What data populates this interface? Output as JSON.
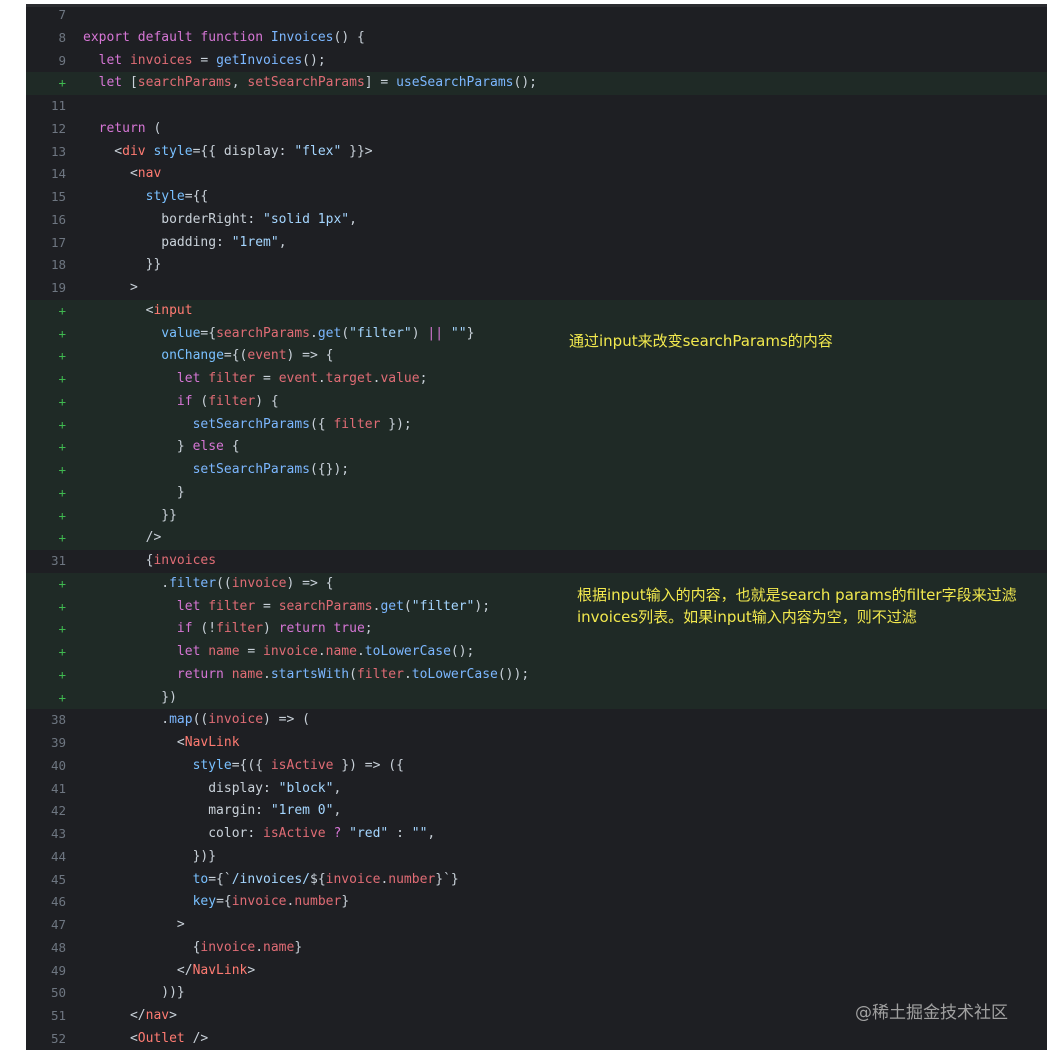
{
  "editor": {
    "lines": [
      {
        "n": "7",
        "added": false,
        "tokens": []
      },
      {
        "n": "8",
        "added": false,
        "tokens": [
          [
            "kw",
            "export "
          ],
          [
            "kw",
            "default "
          ],
          [
            "kw",
            "function "
          ],
          [
            "fn",
            "Invoices"
          ],
          [
            "p",
            "() {"
          ]
        ]
      },
      {
        "n": "9",
        "added": false,
        "tokens": [
          [
            "p",
            "  "
          ],
          [
            "kw",
            "let "
          ],
          [
            "var",
            "invoices"
          ],
          [
            "p",
            " = "
          ],
          [
            "fn",
            "getInvoices"
          ],
          [
            "p",
            "();"
          ]
        ]
      },
      {
        "n": "+",
        "added": true,
        "tokens": [
          [
            "p",
            "  "
          ],
          [
            "kw",
            "let "
          ],
          [
            "p",
            "["
          ],
          [
            "var",
            "searchParams"
          ],
          [
            "p",
            ", "
          ],
          [
            "var",
            "setSearchParams"
          ],
          [
            "p",
            "] = "
          ],
          [
            "fn",
            "useSearchParams"
          ],
          [
            "p",
            "();"
          ]
        ]
      },
      {
        "n": "11",
        "added": false,
        "tokens": []
      },
      {
        "n": "12",
        "added": false,
        "tokens": [
          [
            "p",
            "  "
          ],
          [
            "kw",
            "return "
          ],
          [
            "p",
            "("
          ]
        ]
      },
      {
        "n": "13",
        "added": false,
        "tokens": [
          [
            "p",
            "    <"
          ],
          [
            "tag",
            "div "
          ],
          [
            "attr",
            "style"
          ],
          [
            "p",
            "={{ display: "
          ],
          [
            "str",
            "\"flex\""
          ],
          [
            "p",
            " }}>"
          ]
        ]
      },
      {
        "n": "14",
        "added": false,
        "tokens": [
          [
            "p",
            "      <"
          ],
          [
            "tag",
            "nav"
          ]
        ]
      },
      {
        "n": "15",
        "added": false,
        "tokens": [
          [
            "p",
            "        "
          ],
          [
            "attr",
            "style"
          ],
          [
            "p",
            "={{"
          ]
        ]
      },
      {
        "n": "16",
        "added": false,
        "tokens": [
          [
            "p",
            "          borderRight: "
          ],
          [
            "str",
            "\"solid 1px\""
          ],
          [
            "p",
            ","
          ]
        ]
      },
      {
        "n": "17",
        "added": false,
        "tokens": [
          [
            "p",
            "          padding: "
          ],
          [
            "str",
            "\"1rem\""
          ],
          [
            "p",
            ","
          ]
        ]
      },
      {
        "n": "18",
        "added": false,
        "tokens": [
          [
            "p",
            "        }}"
          ]
        ]
      },
      {
        "n": "19",
        "added": false,
        "tokens": [
          [
            "p",
            "      >"
          ]
        ]
      },
      {
        "n": "+",
        "added": true,
        "tokens": [
          [
            "p",
            "        <"
          ],
          [
            "tag",
            "input"
          ]
        ]
      },
      {
        "n": "+",
        "added": true,
        "tokens": [
          [
            "p",
            "          "
          ],
          [
            "attr",
            "value"
          ],
          [
            "p",
            "={"
          ],
          [
            "var",
            "searchParams"
          ],
          [
            "p",
            "."
          ],
          [
            "fn",
            "get"
          ],
          [
            "p",
            "("
          ],
          [
            "str",
            "\"filter\""
          ],
          [
            "p",
            ") "
          ],
          [
            "kw",
            "||"
          ],
          [
            "p",
            " "
          ],
          [
            "str",
            "\"\""
          ],
          [
            "p",
            "}"
          ]
        ]
      },
      {
        "n": "+",
        "added": true,
        "tokens": [
          [
            "p",
            "          "
          ],
          [
            "attr",
            "onChange"
          ],
          [
            "p",
            "={("
          ],
          [
            "var",
            "event"
          ],
          [
            "p",
            ") => {"
          ]
        ]
      },
      {
        "n": "+",
        "added": true,
        "tokens": [
          [
            "p",
            "            "
          ],
          [
            "kw",
            "let "
          ],
          [
            "var",
            "filter"
          ],
          [
            "p",
            " = "
          ],
          [
            "var",
            "event"
          ],
          [
            "p",
            "."
          ],
          [
            "var",
            "target"
          ],
          [
            "p",
            "."
          ],
          [
            "var",
            "value"
          ],
          [
            "p",
            ";"
          ]
        ]
      },
      {
        "n": "+",
        "added": true,
        "tokens": [
          [
            "p",
            "            "
          ],
          [
            "kw",
            "if "
          ],
          [
            "p",
            "("
          ],
          [
            "var",
            "filter"
          ],
          [
            "p",
            ") {"
          ]
        ]
      },
      {
        "n": "+",
        "added": true,
        "tokens": [
          [
            "p",
            "              "
          ],
          [
            "fn",
            "setSearchParams"
          ],
          [
            "p",
            "({ "
          ],
          [
            "var",
            "filter"
          ],
          [
            "p",
            " });"
          ]
        ]
      },
      {
        "n": "+",
        "added": true,
        "tokens": [
          [
            "p",
            "            } "
          ],
          [
            "kw",
            "else "
          ],
          [
            "p",
            "{"
          ]
        ]
      },
      {
        "n": "+",
        "added": true,
        "tokens": [
          [
            "p",
            "              "
          ],
          [
            "fn",
            "setSearchParams"
          ],
          [
            "p",
            "({});"
          ]
        ]
      },
      {
        "n": "+",
        "added": true,
        "tokens": [
          [
            "p",
            "            }"
          ]
        ]
      },
      {
        "n": "+",
        "added": true,
        "tokens": [
          [
            "p",
            "          }}"
          ]
        ]
      },
      {
        "n": "+",
        "added": true,
        "tokens": [
          [
            "p",
            "        />"
          ]
        ]
      },
      {
        "n": "31",
        "added": false,
        "tokens": [
          [
            "p",
            "        {"
          ],
          [
            "var",
            "invoices"
          ]
        ]
      },
      {
        "n": "+",
        "added": true,
        "tokens": [
          [
            "p",
            "          ."
          ],
          [
            "fn",
            "filter"
          ],
          [
            "p",
            "(("
          ],
          [
            "var",
            "invoice"
          ],
          [
            "p",
            ") => {"
          ]
        ]
      },
      {
        "n": "+",
        "added": true,
        "tokens": [
          [
            "p",
            "            "
          ],
          [
            "kw",
            "let "
          ],
          [
            "var",
            "filter"
          ],
          [
            "p",
            " = "
          ],
          [
            "var",
            "searchParams"
          ],
          [
            "p",
            "."
          ],
          [
            "fn",
            "get"
          ],
          [
            "p",
            "("
          ],
          [
            "str",
            "\"filter\""
          ],
          [
            "p",
            ");"
          ]
        ]
      },
      {
        "n": "+",
        "added": true,
        "tokens": [
          [
            "p",
            "            "
          ],
          [
            "kw",
            "if "
          ],
          [
            "p",
            "(!"
          ],
          [
            "var",
            "filter"
          ],
          [
            "p",
            ") "
          ],
          [
            "kw",
            "return "
          ],
          [
            "kw",
            "true"
          ],
          [
            "p",
            ";"
          ]
        ]
      },
      {
        "n": "+",
        "added": true,
        "tokens": [
          [
            "p",
            "            "
          ],
          [
            "kw",
            "let "
          ],
          [
            "var",
            "name"
          ],
          [
            "p",
            " = "
          ],
          [
            "var",
            "invoice"
          ],
          [
            "p",
            "."
          ],
          [
            "var",
            "name"
          ],
          [
            "p",
            "."
          ],
          [
            "fn",
            "toLowerCase"
          ],
          [
            "p",
            "();"
          ]
        ]
      },
      {
        "n": "+",
        "added": true,
        "tokens": [
          [
            "p",
            "            "
          ],
          [
            "kw",
            "return "
          ],
          [
            "var",
            "name"
          ],
          [
            "p",
            "."
          ],
          [
            "fn",
            "startsWith"
          ],
          [
            "p",
            "("
          ],
          [
            "var",
            "filter"
          ],
          [
            "p",
            "."
          ],
          [
            "fn",
            "toLowerCase"
          ],
          [
            "p",
            "());"
          ]
        ]
      },
      {
        "n": "+",
        "added": true,
        "tokens": [
          [
            "p",
            "          })"
          ]
        ]
      },
      {
        "n": "38",
        "added": false,
        "tokens": [
          [
            "p",
            "          ."
          ],
          [
            "fn",
            "map"
          ],
          [
            "p",
            "(("
          ],
          [
            "var",
            "invoice"
          ],
          [
            "p",
            ") => ("
          ]
        ]
      },
      {
        "n": "39",
        "added": false,
        "tokens": [
          [
            "p",
            "            <"
          ],
          [
            "tag",
            "NavLink"
          ]
        ]
      },
      {
        "n": "40",
        "added": false,
        "tokens": [
          [
            "p",
            "              "
          ],
          [
            "attr",
            "style"
          ],
          [
            "p",
            "={({ "
          ],
          [
            "var",
            "isActive"
          ],
          [
            "p",
            " }) => ({"
          ]
        ]
      },
      {
        "n": "41",
        "added": false,
        "tokens": [
          [
            "p",
            "                display: "
          ],
          [
            "str",
            "\"block\""
          ],
          [
            "p",
            ","
          ]
        ]
      },
      {
        "n": "42",
        "added": false,
        "tokens": [
          [
            "p",
            "                margin: "
          ],
          [
            "str",
            "\"1rem 0\""
          ],
          [
            "p",
            ","
          ]
        ]
      },
      {
        "n": "43",
        "added": false,
        "tokens": [
          [
            "p",
            "                color: "
          ],
          [
            "var",
            "isActive"
          ],
          [
            "p",
            " "
          ],
          [
            "kw",
            "?"
          ],
          [
            "p",
            " "
          ],
          [
            "str",
            "\"red\""
          ],
          [
            "p",
            " : "
          ],
          [
            "str",
            "\"\""
          ],
          [
            "p",
            ","
          ]
        ]
      },
      {
        "n": "44",
        "added": false,
        "tokens": [
          [
            "p",
            "              })}"
          ]
        ]
      },
      {
        "n": "45",
        "added": false,
        "tokens": [
          [
            "p",
            "              "
          ],
          [
            "attr",
            "to"
          ],
          [
            "p",
            "={`"
          ],
          [
            "str",
            "/invoices/"
          ],
          [
            "p",
            "${"
          ],
          [
            "var",
            "invoice"
          ],
          [
            "p",
            "."
          ],
          [
            "var",
            "number"
          ],
          [
            "p",
            "}`}"
          ]
        ]
      },
      {
        "n": "46",
        "added": false,
        "tokens": [
          [
            "p",
            "              "
          ],
          [
            "attr",
            "key"
          ],
          [
            "p",
            "={"
          ],
          [
            "var",
            "invoice"
          ],
          [
            "p",
            "."
          ],
          [
            "var",
            "number"
          ],
          [
            "p",
            "}"
          ]
        ]
      },
      {
        "n": "47",
        "added": false,
        "tokens": [
          [
            "p",
            "            >"
          ]
        ]
      },
      {
        "n": "48",
        "added": false,
        "tokens": [
          [
            "p",
            "              {"
          ],
          [
            "var",
            "invoice"
          ],
          [
            "p",
            "."
          ],
          [
            "var",
            "name"
          ],
          [
            "p",
            "}"
          ]
        ]
      },
      {
        "n": "49",
        "added": false,
        "tokens": [
          [
            "p",
            "            </"
          ],
          [
            "tag",
            "NavLink"
          ],
          [
            "p",
            ">"
          ]
        ]
      },
      {
        "n": "50",
        "added": false,
        "tokens": [
          [
            "p",
            "          ))}"
          ]
        ]
      },
      {
        "n": "51",
        "added": false,
        "tokens": [
          [
            "p",
            "      </"
          ],
          [
            "tag",
            "nav"
          ],
          [
            "p",
            ">"
          ]
        ]
      },
      {
        "n": "52",
        "added": false,
        "tokens": [
          [
            "p",
            "      <"
          ],
          [
            "tag",
            "Outlet"
          ],
          [
            "p",
            " />"
          ]
        ]
      },
      {
        "n": "",
        "added": false,
        "tokens": [
          [
            "p",
            "    </"
          ]
        ]
      }
    ]
  },
  "annotations": {
    "note1": "通过input来改变searchParams的内容",
    "note2_line1": "根据input输入的内容，也就是search params的filter字段来过滤",
    "note2_line2": "invoices列表。如果input输入内容为空，则不过滤"
  },
  "watermark": "@稀土掘金技术社区"
}
